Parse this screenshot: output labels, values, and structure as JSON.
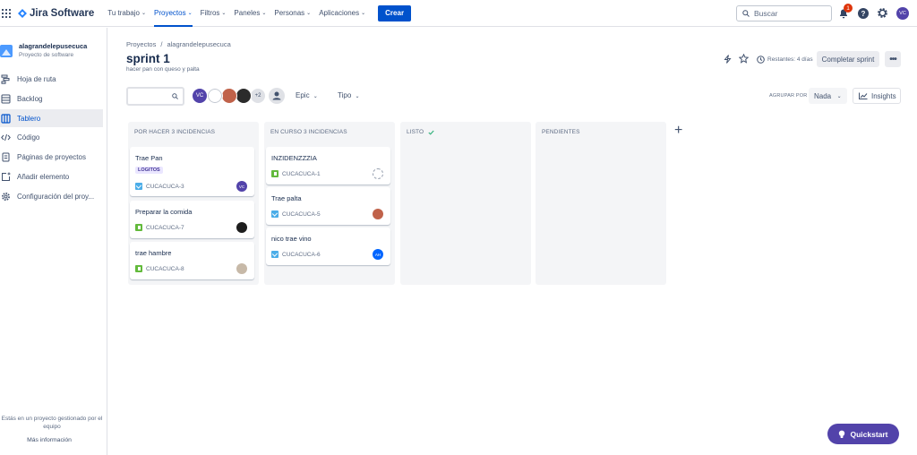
{
  "topnav": {
    "logo": "Jira Software",
    "items": [
      {
        "label": "Tu trabajo",
        "active": false
      },
      {
        "label": "Proyectos",
        "active": true
      },
      {
        "label": "Filtros",
        "active": false
      },
      {
        "label": "Paneles",
        "active": false
      },
      {
        "label": "Personas",
        "active": false
      },
      {
        "label": "Aplicaciones",
        "active": false
      }
    ],
    "create_label": "Crear",
    "search_placeholder": "Buscar",
    "notifications_count": "1",
    "help_glyph": "?",
    "user_initials": "VC"
  },
  "sidebar": {
    "project_name": "alagrandelepusecuca",
    "project_type": "Proyecto de software",
    "items": [
      {
        "label": "Hoja de ruta",
        "icon": "roadmap-icon",
        "active": false
      },
      {
        "label": "Backlog",
        "icon": "backlog-icon",
        "active": false
      },
      {
        "label": "Tablero",
        "icon": "board-icon",
        "active": true
      },
      {
        "label": "Código",
        "icon": "code-icon",
        "active": false
      },
      {
        "label": "Páginas de proyectos",
        "icon": "pages-icon",
        "active": false
      },
      {
        "label": "Añadir elemento",
        "icon": "add-item-icon",
        "active": false
      },
      {
        "label": "Configuración del proy...",
        "icon": "settings-icon",
        "active": false
      }
    ],
    "footer_text": "Estás en un proyecto gestionado por el equipo",
    "more_info": "Más información"
  },
  "header": {
    "breadcrumb": [
      "Proyectos",
      "alagrandelepusecuca"
    ],
    "breadcrumb_sep": "/",
    "title": "sprint 1",
    "subtitle": "hacer pan con queso y palta",
    "remaining": "Restantes: 4 días",
    "complete_label": "Completar sprint",
    "more_label": "•••"
  },
  "filters": {
    "avatars": [
      {
        "initials": "VC",
        "color": "#5243aa"
      },
      {
        "initials": "",
        "color": "#ffffff"
      },
      {
        "initials": "",
        "color": "#c0624a"
      },
      {
        "initials": "",
        "color": "#2b2b2b"
      },
      {
        "initials": "+2",
        "color": "#dfe1e6"
      }
    ],
    "epic_label": "Epic",
    "type_label": "Tipo",
    "group_by_label": "AGRUPAR POR",
    "group_by_value": "Nada",
    "insights_label": "Insights"
  },
  "columns": [
    {
      "title": "POR HACER 3 INCIDENCIAS",
      "check": false,
      "cards": [
        {
          "title": "Trae Pan",
          "label": "LOGITOS",
          "key": "CUCACUCA-3",
          "type": "task",
          "assignee": "VC",
          "assignee_color": "#5243aa"
        },
        {
          "title": "Preparar la comida",
          "label": "",
          "key": "CUCACUCA-7",
          "type": "story",
          "assignee": "",
          "assignee_color": "#1d1d1d"
        },
        {
          "title": "trae hambre",
          "label": "",
          "key": "CUCACUCA-8",
          "type": "story",
          "assignee": "",
          "assignee_color": "#c7b9a8"
        }
      ]
    },
    {
      "title": "EN CURSO 3 INCIDENCIAS",
      "check": false,
      "cards": [
        {
          "title": "INZIDENZZZIA",
          "label": "",
          "key": "CUCACUCA-1",
          "type": "story",
          "assignee": "",
          "assignee_color": "loading"
        },
        {
          "title": "Trae palta",
          "label": "",
          "key": "CUCACUCA-5",
          "type": "task",
          "assignee": "",
          "assignee_color": "#c0624a"
        },
        {
          "title": "nico trae vino",
          "label": "",
          "key": "CUCACUCA-6",
          "type": "task",
          "assignee": "AH",
          "assignee_color": "#0065ff"
        }
      ]
    },
    {
      "title": "LISTO",
      "check": true,
      "cards": []
    },
    {
      "title": "PENDIENTES",
      "check": false,
      "cards": []
    }
  ],
  "add_column_glyph": "+",
  "quickstart_label": "Quickstart"
}
